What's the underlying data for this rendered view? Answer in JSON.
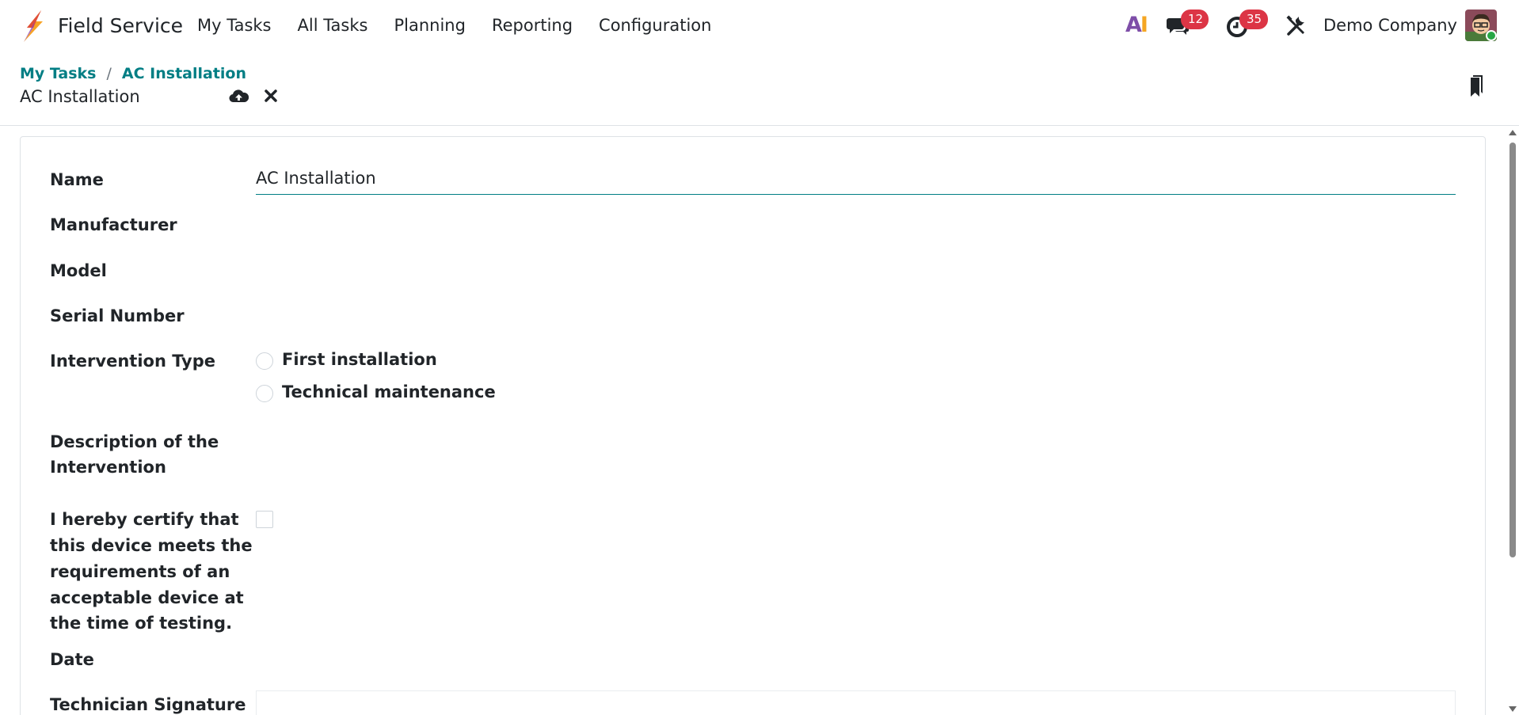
{
  "navbar": {
    "app_name": "Field Service",
    "menu": [
      "My Tasks",
      "All Tasks",
      "Planning",
      "Reporting",
      "Configuration"
    ],
    "ai_label": "AI",
    "messages_count": "12",
    "activities_count": "35",
    "company": "Demo Company"
  },
  "control_panel": {
    "breadcrumb": [
      "My Tasks",
      "AC Installation"
    ],
    "breadcrumb_separator": "/",
    "record_title": "AC Installation"
  },
  "form": {
    "name_label": "Name",
    "name_value": "AC Installation",
    "manufacturer_label": "Manufacturer",
    "model_label": "Model",
    "serial_label": "Serial Number",
    "intervention_label": "Intervention Type",
    "intervention_options": [
      "First installation",
      "Technical maintenance"
    ],
    "description_label_line1": "Description of the",
    "description_label_line2": "Intervention",
    "certify_lines": [
      "I hereby certify that",
      "this device meets the",
      "requirements of an",
      "acceptable device at",
      "the time of testing."
    ],
    "date_label": "Date",
    "signature_label": "Technician Signature"
  },
  "colors": {
    "accent": "#017e84",
    "badge": "#dc3545",
    "presence": "#28a745"
  }
}
